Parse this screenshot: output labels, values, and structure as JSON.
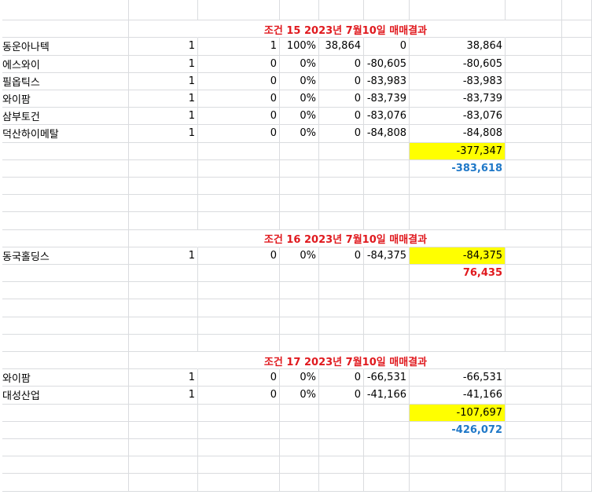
{
  "sections": [
    {
      "title": "조건 15 2023년 7월10일  매매결과",
      "rows": [
        [
          "동운아나텍",
          "1",
          "1",
          "100%",
          "38,864",
          "0",
          "38,864"
        ],
        [
          "에스와이",
          "1",
          "0",
          "0%",
          "0",
          "-80,605",
          "-80,605"
        ],
        [
          "필옵틱스",
          "1",
          "0",
          "0%",
          "0",
          "-83,983",
          "-83,983"
        ],
        [
          "와이팜",
          "1",
          "0",
          "0%",
          "0",
          "-83,739",
          "-83,739"
        ],
        [
          "삼부토건",
          "1",
          "0",
          "0%",
          "0",
          "-83,076",
          "-83,076"
        ],
        [
          "덕산하이메탈",
          "1",
          "0",
          "0%",
          "0",
          "-84,808",
          "-84,808"
        ]
      ],
      "subtotal": "-377,347",
      "cumulative": "-383,618",
      "cumulative_color": "blue"
    },
    {
      "title": "조건 16 2023년 7월10일  매매결과",
      "rows": [
        [
          "동국홀딩스",
          "1",
          "0",
          "0%",
          "0",
          "-84,375",
          "-84,375"
        ]
      ],
      "cumulative": "76,435",
      "cumulative_color": "red"
    },
    {
      "title": "조건 17 2023년 7월10일  매매결과",
      "rows": [
        [
          "와이팜",
          "1",
          "0",
          "0%",
          "0",
          "-66,531",
          "-66,531"
        ],
        [
          "대성산업",
          "1",
          "0",
          "0%",
          "0",
          "-41,166",
          "-41,166"
        ]
      ],
      "subtotal": "-107,697",
      "cumulative": "-426,072",
      "cumulative_color": "blue"
    }
  ],
  "colors": {
    "title": "#e0191e",
    "highlight": "#ffff00",
    "cumulative_blue": "#1f78c8",
    "cumulative_red": "#e0191e",
    "gridline": "#dadcdf"
  }
}
